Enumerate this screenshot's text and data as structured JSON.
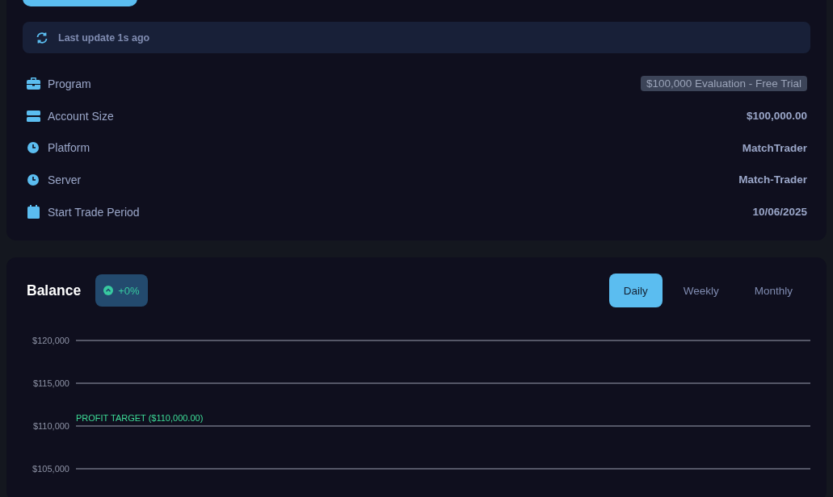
{
  "last_update": {
    "text": "Last update 1s ago"
  },
  "details": [
    {
      "kind": "badge",
      "label": "Program",
      "value": "$100,000 Evaluation - Free Trial"
    },
    {
      "kind": "text",
      "label": "Account Size",
      "value": "$100,000.00"
    },
    {
      "kind": "text",
      "label": "Platform",
      "value": "MatchTrader"
    },
    {
      "kind": "text",
      "label": "Server",
      "value": "Match-Trader"
    },
    {
      "kind": "text",
      "label": "Start Trade Period",
      "value": "10/06/2025"
    }
  ],
  "balance": {
    "title": "Balance",
    "change": "+0%",
    "periods": [
      {
        "label": "Daily",
        "selected": true
      },
      {
        "label": "Weekly",
        "selected": false
      },
      {
        "label": "Monthly",
        "selected": false
      }
    ],
    "axis_labels": [
      "$120,000",
      "$115,000",
      "$110,000",
      "$105,000"
    ],
    "profit_target": "PROFIT TARGET ($110,000.00)"
  }
}
